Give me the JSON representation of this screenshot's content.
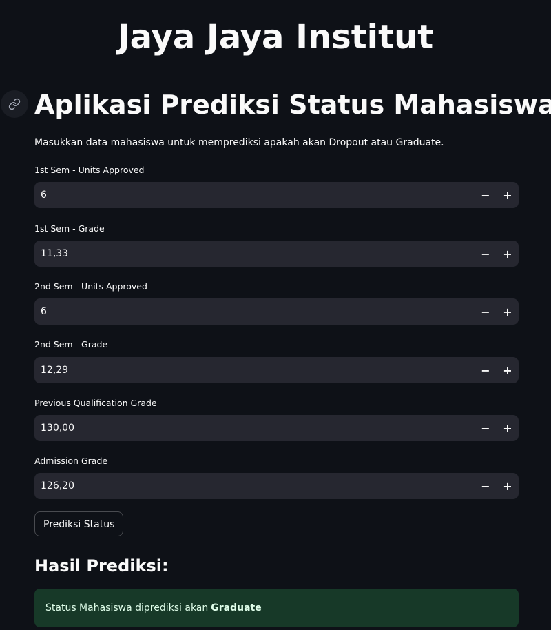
{
  "header": {
    "title": "Jaya Jaya Institut"
  },
  "app": {
    "title": "Aplikasi Prediksi Status Mahasiswa",
    "description": "Masukkan data mahasiswa untuk memprediksi apakah akan Dropout atau Graduate."
  },
  "fields": [
    {
      "label": "1st Sem - Units Approved",
      "value": "6",
      "minus": "−",
      "plus": "+"
    },
    {
      "label": "1st Sem - Grade",
      "value": "11,33",
      "minus": "−",
      "plus": "+"
    },
    {
      "label": "2nd Sem - Units Approved",
      "value": "6",
      "minus": "−",
      "plus": "+"
    },
    {
      "label": "2nd Sem - Grade",
      "value": "12,29",
      "minus": "−",
      "plus": "+"
    },
    {
      "label": "Previous Qualification Grade",
      "value": "130,00",
      "minus": "−",
      "plus": "+"
    },
    {
      "label": "Admission Grade",
      "value": "126,20",
      "minus": "−",
      "plus": "+"
    }
  ],
  "predict_button": {
    "label": "Prediksi Status"
  },
  "result": {
    "heading": "Hasil Prediksi:",
    "message_prefix": "Status Mahasiswa diprediksi akan",
    "status": "Graduate"
  },
  "icons": {
    "anchor": "link-icon"
  },
  "colors": {
    "background": "#0e1117",
    "input_background": "#262730",
    "success_background": "#173928",
    "text": "#fafafa"
  }
}
